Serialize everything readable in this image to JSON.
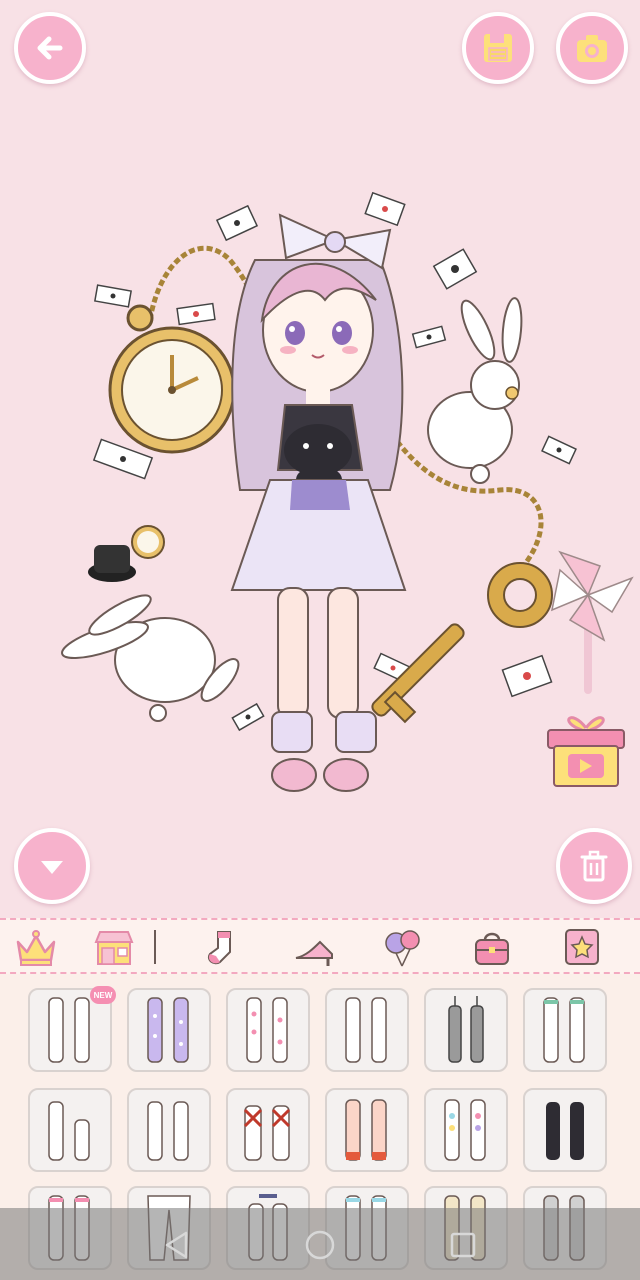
{
  "top_bar": {
    "back_icon": "arrow-left-icon",
    "save_icon": "floppy-disk-icon",
    "camera_icon": "camera-icon"
  },
  "stage": {
    "scroll_down_icon": "triangle-down-icon",
    "trash_icon": "trash-icon",
    "gift_icon": "gift-video-icon"
  },
  "toolbar": {
    "items": [
      {
        "icon": "crown-icon"
      },
      {
        "icon": "shop-icon"
      },
      {
        "icon": "sock-icon"
      },
      {
        "icon": "high-heel-icon"
      },
      {
        "icon": "balloons-icon"
      },
      {
        "icon": "bag-icon"
      },
      {
        "icon": "star-icon"
      }
    ]
  },
  "items_grid": {
    "new_badge": "NEW",
    "items": [
      "white-knee-socks",
      "lavender-polka-stockings",
      "pink-heart-stockings",
      "white-ruffle-stockings",
      "fishnet-stockings",
      "white-ribbon-stockings",
      "white-ankle-socks",
      "white-lace-socks",
      "red-ribbon-socks",
      "red-striped-socks",
      "heart-print-socks",
      "black-thigh-highs",
      "pink-bow-stockings",
      "sheer-tights",
      "navy-bow-stockings",
      "blue-lace-stockings",
      "beige-lace-stockings",
      "gray-stockings"
    ]
  },
  "colors": {
    "background": "#f8e1e6",
    "button_pink": "#f7b2cc",
    "accent": "#f3a9c0",
    "panel": "#fbefe9"
  }
}
